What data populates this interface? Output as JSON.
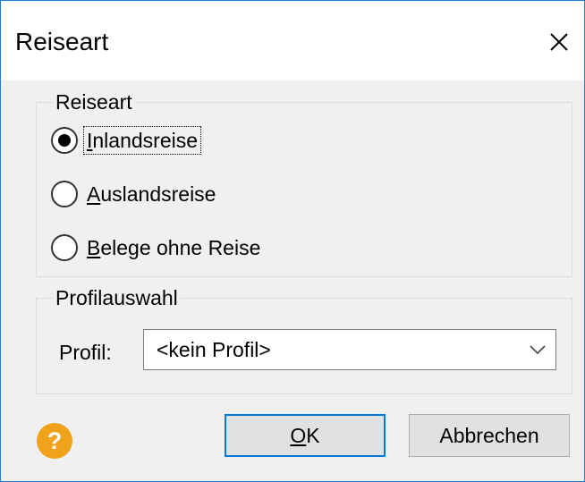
{
  "window": {
    "title": "Reiseart",
    "close_icon": "close-icon",
    "border_color": "#1e7fd8"
  },
  "reiseart_group": {
    "legend": "Reiseart",
    "options": [
      {
        "mnemonic": "I",
        "rest": "nlandsreise",
        "label": "Inlandsreise",
        "selected": true
      },
      {
        "mnemonic": "A",
        "rest": "uslandsreise",
        "label": "Auslandsreise",
        "selected": false
      },
      {
        "mnemonic": "B",
        "rest": "elege ohne Reise",
        "label": "Belege ohne Reise",
        "selected": false
      }
    ]
  },
  "profil_group": {
    "legend": "Profilauswahl",
    "label": "Profil:",
    "selected_value": "<kein Profil>",
    "dropdown_icon": "chevron-down-icon"
  },
  "footer": {
    "help_glyph": "?",
    "help_icon": "help-icon",
    "help_color": "#f0a21b",
    "ok_mnemonic": "O",
    "ok_rest": "K",
    "ok_label": "OK",
    "ok_border_color": "#0078d7",
    "cancel_label": "Abbrechen"
  }
}
